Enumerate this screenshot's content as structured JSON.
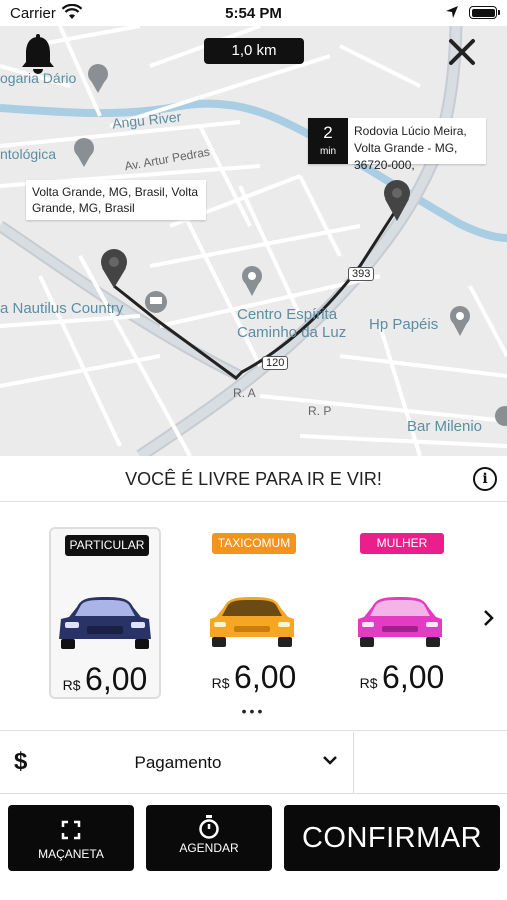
{
  "status_bar": {
    "carrier": "Carrier",
    "time": "5:54 PM"
  },
  "map": {
    "distance": "1,0 km",
    "labels": {
      "drogaria": "ogaria Dário",
      "river": "Angu River",
      "odontologica": "ntológica",
      "street_artur": "Av. Artur Pedras",
      "nautilus": "a Nautilus Country",
      "centro_line1": "Centro Espírita",
      "centro_line2": "Caminho da Luz",
      "hp": "Hp Papéis",
      "bar": "Bar Milenio",
      "road_a": "R. A",
      "road_p": "R. P",
      "shield_393": "393",
      "shield_120": "120"
    },
    "origin_tooltip": "Volta Grande, MG, Brasil, Volta Grande, MG, Brasil",
    "destination_tooltip": {
      "eta_value": "2",
      "eta_unit": "min",
      "address": "Rodovia Lúcio Meira, Volta Grande - MG, 36720-000,"
    }
  },
  "slogan": "VOCÊ É LIVRE PARA IR E VIR!",
  "categories": [
    {
      "tag": "PARTICULAR",
      "currency": "R$",
      "price": "6,00",
      "tag_color": "#111111",
      "car_color": "#2a3366",
      "selected": true
    },
    {
      "tag": "TAXICOMUM",
      "currency": "R$",
      "price": "6,00",
      "tag_color": "#f5931f",
      "car_color": "#f5a623",
      "selected": false
    },
    {
      "tag": "MULHER",
      "currency": "R$",
      "price": "6,00",
      "tag_color": "#ea1f8c",
      "car_color": "#e33bc1",
      "selected": false
    }
  ],
  "pager_dots": "•••",
  "payment": {
    "icon": "$",
    "label": "Pagamento"
  },
  "buttons": {
    "macaneta": "MAÇANETA",
    "agendar": "AGENDAR",
    "confirmar": "CONFIRMAR"
  },
  "icons": [
    "bell-icon",
    "close-icon",
    "info-icon",
    "chevron-right-icon",
    "chevron-down-icon",
    "expand-icon",
    "stopwatch-icon",
    "wifi-icon",
    "location-arrow-icon",
    "battery-icon"
  ]
}
